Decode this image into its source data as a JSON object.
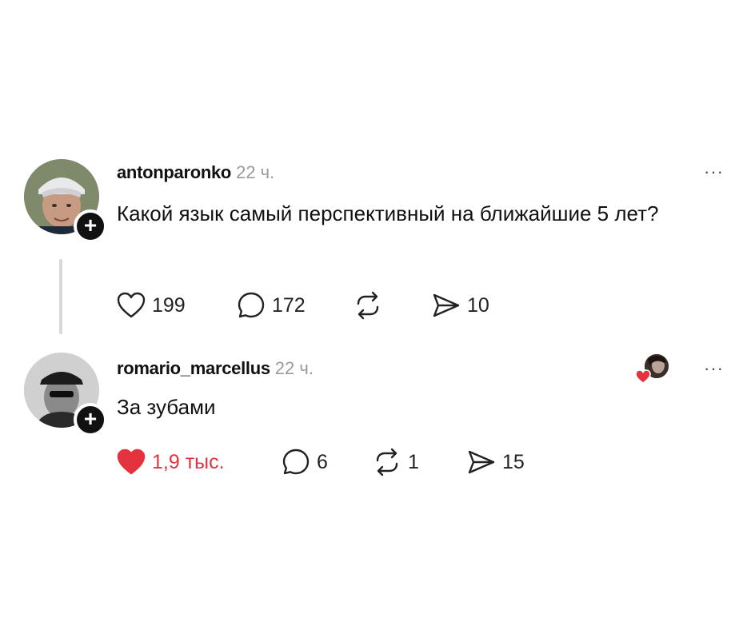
{
  "posts": [
    {
      "username": "antonparonko",
      "time": "22 ч.",
      "text": "Какой язык самый перспективный на ближайшие 5 лет?",
      "more": "···",
      "follow": "+",
      "actions": {
        "likes": "199",
        "replies": "172",
        "reposts": "",
        "shares": "10"
      },
      "liked": false
    },
    {
      "username": "romario_marcellus",
      "time": "22 ч.",
      "text": "За зубами",
      "more": "···",
      "follow": "+",
      "actions": {
        "likes": "1,9 тыс.",
        "replies": "6",
        "reposts": "1",
        "shares": "15"
      },
      "liked": true
    }
  ],
  "colors": {
    "like_active": "#e4323f",
    "muted": "#9a9a9a",
    "text": "#111111"
  },
  "icons": [
    "heart-icon",
    "reply-bubble-icon",
    "repost-icon",
    "share-plane-icon",
    "more-dots-icon",
    "plus-icon"
  ]
}
